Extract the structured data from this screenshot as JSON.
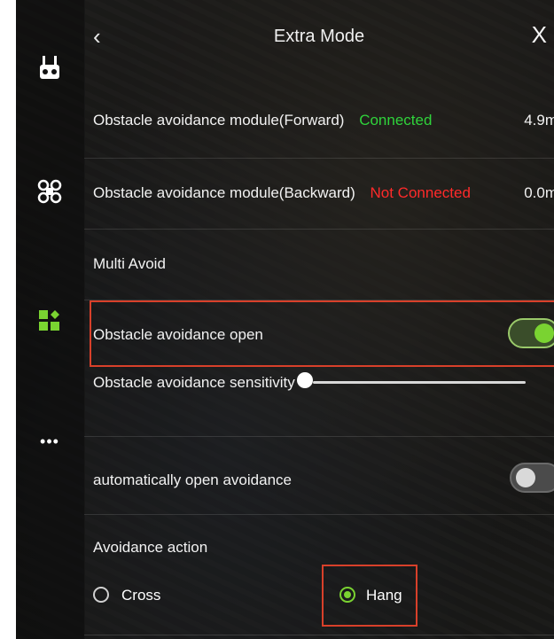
{
  "header": {
    "back_icon": "‹",
    "title": "Extra Mode",
    "close_icon": "X"
  },
  "sidebar": {
    "items": [
      {
        "name": "remote-controller-icon"
      },
      {
        "name": "drone-icon"
      },
      {
        "name": "modules-icon",
        "active": true
      },
      {
        "name": "more-icon",
        "symbol": "•••"
      }
    ]
  },
  "rows": {
    "forward": {
      "label": "Obstacle avoidance module(Forward)",
      "status": "Connected",
      "status_color": "#2fd33b",
      "value": "4.9m"
    },
    "backward": {
      "label": "Obstacle avoidance module(Backward)",
      "status": "Not Connected",
      "status_color": "#ff2a2a",
      "value": "0.0m"
    },
    "multi_avoid": {
      "label": "Multi Avoid"
    },
    "avoidance_open": {
      "label": "Obstacle avoidance open",
      "enabled": true
    },
    "sensitivity": {
      "label": "Obstacle avoidance sensitivity",
      "level": 0.0
    },
    "auto_open": {
      "label": "automatically open avoidance",
      "enabled": false
    },
    "action": {
      "label": "Avoidance action",
      "options": [
        "Cross",
        "Hang"
      ],
      "selected": "Hang"
    }
  },
  "colors": {
    "accent": "#7ad331",
    "highlight_border": "#d8402a"
  }
}
